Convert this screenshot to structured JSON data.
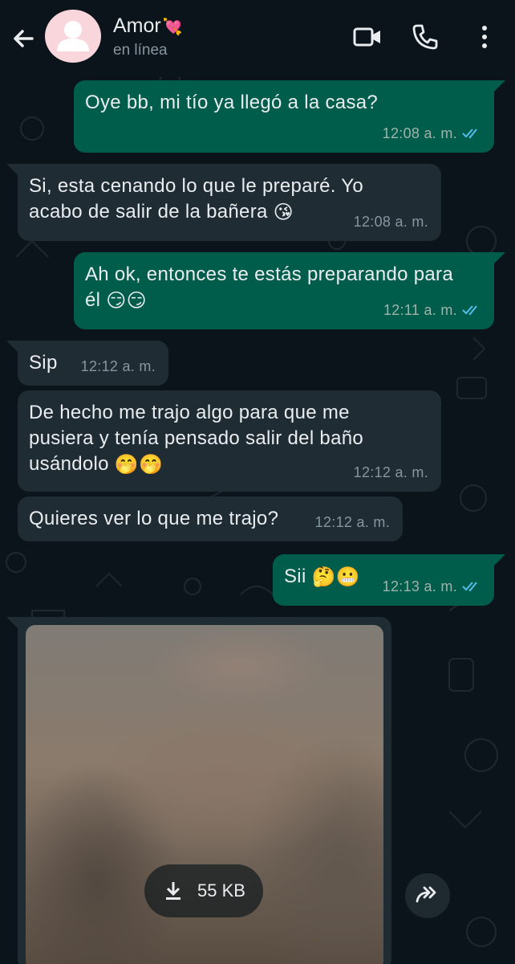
{
  "header": {
    "contact_name": "Amor",
    "contact_emoji": "💘",
    "status": "en línea",
    "icons": [
      "back-arrow-icon",
      "video-call-icon",
      "phone-icon",
      "more-options-icon"
    ]
  },
  "colors": {
    "background": "#0b141a",
    "outgoing_bubble": "#005c4b",
    "incoming_bubble": "#202c33",
    "read_ticks": "#53bdeb",
    "avatar_bg": "#f8d6dc"
  },
  "messages": [
    {
      "direction": "outgoing",
      "text": "Oye bb, mi tío ya llegó a la casa?",
      "time": "12:08 a. m.",
      "read": true
    },
    {
      "direction": "incoming",
      "line1": "Si, esta cenando lo que le preparé. Yo",
      "line2": "acabo de salir de la bañera",
      "emoji": "😘",
      "time": "12:08 a. m."
    },
    {
      "direction": "outgoing",
      "line1": "Ah ok, entonces te estás preparando para",
      "line2": "él",
      "emoji": "😏😏",
      "time": "12:11 a. m.",
      "read": true
    },
    {
      "direction": "incoming",
      "text": "Sip",
      "time": "12:12 a. m."
    },
    {
      "direction": "incoming",
      "line1": "De hecho me trajo algo para que me",
      "line2": "pusiera y tenía pensado salir del baño",
      "line3": "usándolo",
      "emoji": "🤭🤭",
      "time": "12:12 a. m."
    },
    {
      "direction": "incoming",
      "text": "Quieres ver lo que me trajo?",
      "time": "12:12 a. m."
    },
    {
      "direction": "outgoing",
      "text": "Sii",
      "emoji": "🤔😬",
      "time": "12:13 a. m.",
      "read": true
    }
  ],
  "image_message": {
    "direction": "incoming",
    "blurred": true,
    "download_size": "55 KB",
    "icons": [
      "download-icon",
      "forward-icon"
    ]
  }
}
